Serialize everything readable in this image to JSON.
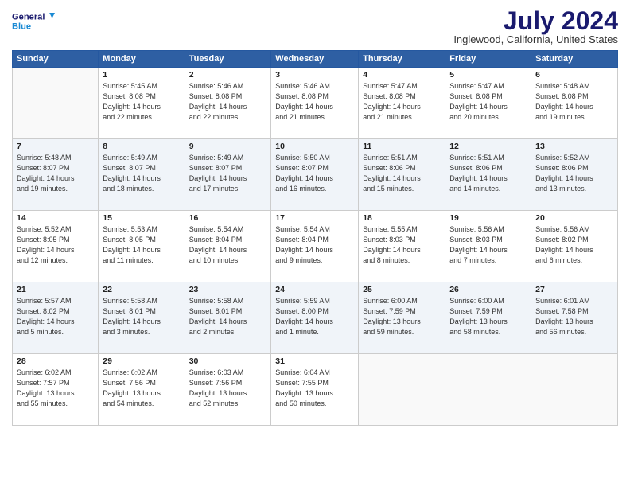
{
  "header": {
    "logo_line1": "General",
    "logo_line2": "Blue",
    "title": "July 2024",
    "location": "Inglewood, California, United States"
  },
  "weekdays": [
    "Sunday",
    "Monday",
    "Tuesday",
    "Wednesday",
    "Thursday",
    "Friday",
    "Saturday"
  ],
  "weeks": [
    [
      {
        "day": "",
        "info": ""
      },
      {
        "day": "1",
        "info": "Sunrise: 5:45 AM\nSunset: 8:08 PM\nDaylight: 14 hours\nand 22 minutes."
      },
      {
        "day": "2",
        "info": "Sunrise: 5:46 AM\nSunset: 8:08 PM\nDaylight: 14 hours\nand 22 minutes."
      },
      {
        "day": "3",
        "info": "Sunrise: 5:46 AM\nSunset: 8:08 PM\nDaylight: 14 hours\nand 21 minutes."
      },
      {
        "day": "4",
        "info": "Sunrise: 5:47 AM\nSunset: 8:08 PM\nDaylight: 14 hours\nand 21 minutes."
      },
      {
        "day": "5",
        "info": "Sunrise: 5:47 AM\nSunset: 8:08 PM\nDaylight: 14 hours\nand 20 minutes."
      },
      {
        "day": "6",
        "info": "Sunrise: 5:48 AM\nSunset: 8:08 PM\nDaylight: 14 hours\nand 19 minutes."
      }
    ],
    [
      {
        "day": "7",
        "info": "Sunrise: 5:48 AM\nSunset: 8:07 PM\nDaylight: 14 hours\nand 19 minutes."
      },
      {
        "day": "8",
        "info": "Sunrise: 5:49 AM\nSunset: 8:07 PM\nDaylight: 14 hours\nand 18 minutes."
      },
      {
        "day": "9",
        "info": "Sunrise: 5:49 AM\nSunset: 8:07 PM\nDaylight: 14 hours\nand 17 minutes."
      },
      {
        "day": "10",
        "info": "Sunrise: 5:50 AM\nSunset: 8:07 PM\nDaylight: 14 hours\nand 16 minutes."
      },
      {
        "day": "11",
        "info": "Sunrise: 5:51 AM\nSunset: 8:06 PM\nDaylight: 14 hours\nand 15 minutes."
      },
      {
        "day": "12",
        "info": "Sunrise: 5:51 AM\nSunset: 8:06 PM\nDaylight: 14 hours\nand 14 minutes."
      },
      {
        "day": "13",
        "info": "Sunrise: 5:52 AM\nSunset: 8:06 PM\nDaylight: 14 hours\nand 13 minutes."
      }
    ],
    [
      {
        "day": "14",
        "info": "Sunrise: 5:52 AM\nSunset: 8:05 PM\nDaylight: 14 hours\nand 12 minutes."
      },
      {
        "day": "15",
        "info": "Sunrise: 5:53 AM\nSunset: 8:05 PM\nDaylight: 14 hours\nand 11 minutes."
      },
      {
        "day": "16",
        "info": "Sunrise: 5:54 AM\nSunset: 8:04 PM\nDaylight: 14 hours\nand 10 minutes."
      },
      {
        "day": "17",
        "info": "Sunrise: 5:54 AM\nSunset: 8:04 PM\nDaylight: 14 hours\nand 9 minutes."
      },
      {
        "day": "18",
        "info": "Sunrise: 5:55 AM\nSunset: 8:03 PM\nDaylight: 14 hours\nand 8 minutes."
      },
      {
        "day": "19",
        "info": "Sunrise: 5:56 AM\nSunset: 8:03 PM\nDaylight: 14 hours\nand 7 minutes."
      },
      {
        "day": "20",
        "info": "Sunrise: 5:56 AM\nSunset: 8:02 PM\nDaylight: 14 hours\nand 6 minutes."
      }
    ],
    [
      {
        "day": "21",
        "info": "Sunrise: 5:57 AM\nSunset: 8:02 PM\nDaylight: 14 hours\nand 5 minutes."
      },
      {
        "day": "22",
        "info": "Sunrise: 5:58 AM\nSunset: 8:01 PM\nDaylight: 14 hours\nand 3 minutes."
      },
      {
        "day": "23",
        "info": "Sunrise: 5:58 AM\nSunset: 8:01 PM\nDaylight: 14 hours\nand 2 minutes."
      },
      {
        "day": "24",
        "info": "Sunrise: 5:59 AM\nSunset: 8:00 PM\nDaylight: 14 hours\nand 1 minute."
      },
      {
        "day": "25",
        "info": "Sunrise: 6:00 AM\nSunset: 7:59 PM\nDaylight: 13 hours\nand 59 minutes."
      },
      {
        "day": "26",
        "info": "Sunrise: 6:00 AM\nSunset: 7:59 PM\nDaylight: 13 hours\nand 58 minutes."
      },
      {
        "day": "27",
        "info": "Sunrise: 6:01 AM\nSunset: 7:58 PM\nDaylight: 13 hours\nand 56 minutes."
      }
    ],
    [
      {
        "day": "28",
        "info": "Sunrise: 6:02 AM\nSunset: 7:57 PM\nDaylight: 13 hours\nand 55 minutes."
      },
      {
        "day": "29",
        "info": "Sunrise: 6:02 AM\nSunset: 7:56 PM\nDaylight: 13 hours\nand 54 minutes."
      },
      {
        "day": "30",
        "info": "Sunrise: 6:03 AM\nSunset: 7:56 PM\nDaylight: 13 hours\nand 52 minutes."
      },
      {
        "day": "31",
        "info": "Sunrise: 6:04 AM\nSunset: 7:55 PM\nDaylight: 13 hours\nand 50 minutes."
      },
      {
        "day": "",
        "info": ""
      },
      {
        "day": "",
        "info": ""
      },
      {
        "day": "",
        "info": ""
      }
    ]
  ]
}
